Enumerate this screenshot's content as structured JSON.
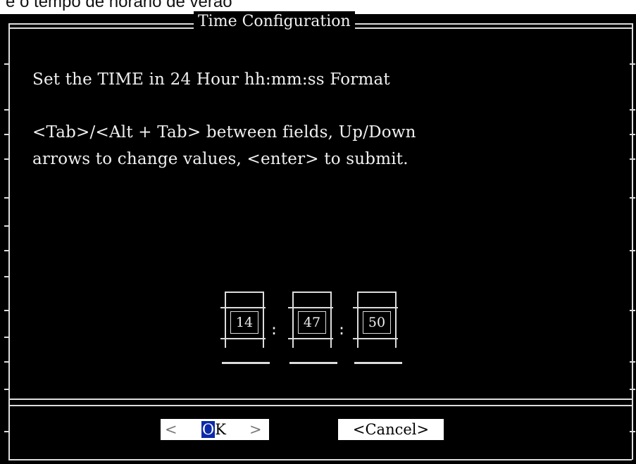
{
  "page_caption": "e o tempo de horário de verão",
  "dialog": {
    "title": "Time Configuration",
    "instruction": "Set the TIME in 24 Hour hh:mm:ss Format",
    "help_line_1": "<Tab>/<Alt + Tab> between fields, Up/Down",
    "help_line_2": "arrows to change values, <enter> to submit."
  },
  "time": {
    "hours": "14",
    "minutes": "47",
    "seconds": "50",
    "separator": ":"
  },
  "buttons": {
    "ok_left_bracket": "<",
    "ok_hotkey": "O",
    "ok_rest": "K",
    "ok_right_bracket": ">",
    "cancel": "<Cancel>"
  },
  "colors": {
    "background": "#000000",
    "foreground": "#f0f0f0",
    "frame": "#dddddd",
    "button_bg": "#ffffff",
    "hotkey_bg": "#0b2aa8"
  }
}
